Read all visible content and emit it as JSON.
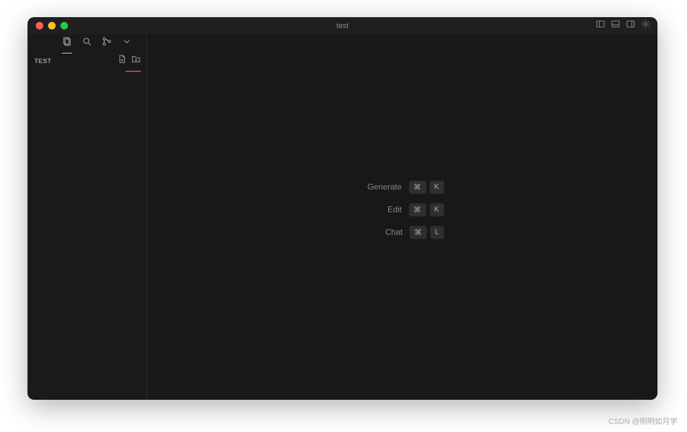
{
  "window": {
    "title": "test"
  },
  "sidebar": {
    "title": "TEST"
  },
  "shortcuts": [
    {
      "label": "Generate",
      "keys": [
        "⌘",
        "K"
      ]
    },
    {
      "label": "Edit",
      "keys": [
        "⌘",
        "K"
      ]
    },
    {
      "label": "Chat",
      "keys": [
        "⌘",
        "L"
      ]
    }
  ],
  "watermark": "CSDN @明明如月学"
}
